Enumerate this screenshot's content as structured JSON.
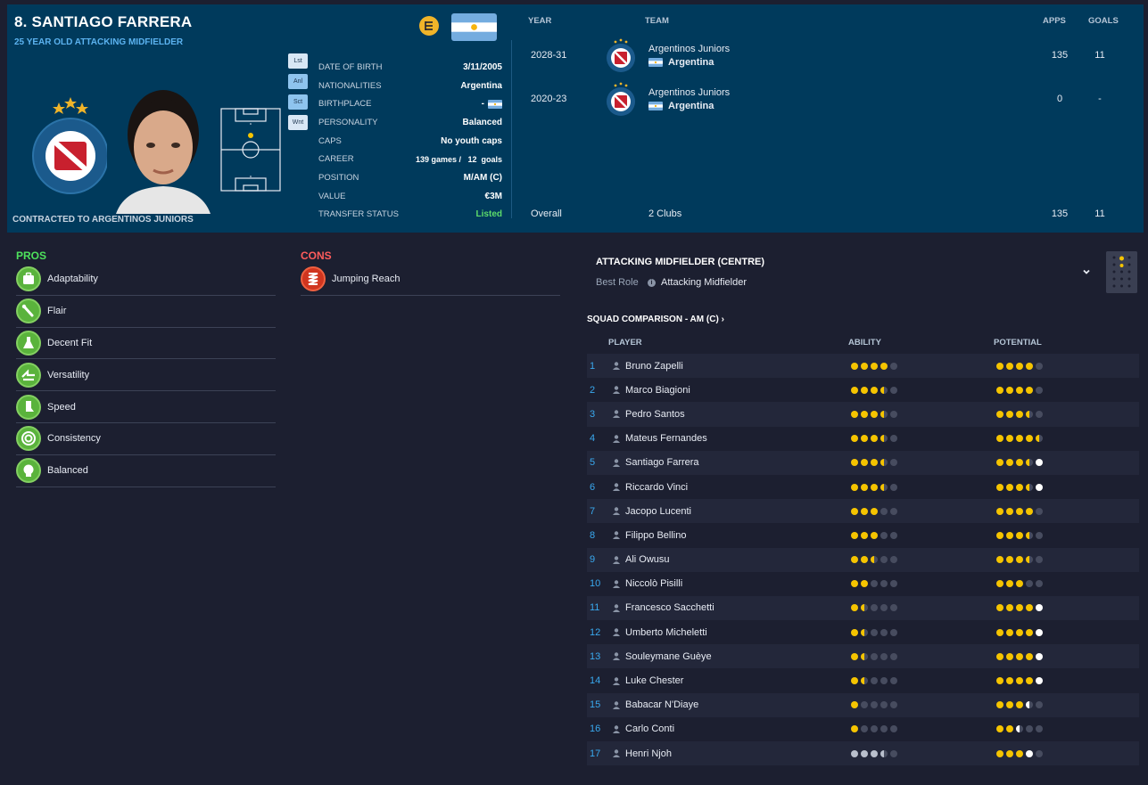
{
  "player": {
    "name": "8. SANTIAGO FARRERA",
    "subtitle": "25 YEAR OLD ATTACKING MIDFIELDER",
    "contract": "CONTRACTED TO ARGENTINOS JUNIORS"
  },
  "side_tabs": [
    "Lst",
    "Anl",
    "Sct",
    "Wnt"
  ],
  "info": {
    "rows": [
      {
        "label": "DATE OF BIRTH",
        "value": "3/11/2005"
      },
      {
        "label": "NATIONALITIES",
        "value": "Argentina"
      },
      {
        "label": "BIRTHPLACE",
        "value": "-"
      },
      {
        "label": "PERSONALITY",
        "value": "Balanced"
      },
      {
        "label": "CAPS",
        "value": "No youth caps"
      },
      {
        "label": "CAREER",
        "value": "139 games /   12  goals"
      },
      {
        "label": "POSITION",
        "value": "M/AM (C)"
      },
      {
        "label": "VALUE",
        "value": "€3M"
      },
      {
        "label": "TRANSFER STATUS",
        "value": "Listed"
      }
    ]
  },
  "history": {
    "headers": {
      "year": "YEAR",
      "team": "TEAM",
      "apps": "APPS",
      "goals": "GOALS"
    },
    "rows": [
      {
        "year": "2028-31",
        "club": "Argentinos Juniors",
        "nation": "Argentina",
        "apps": "135",
        "goals": "11"
      },
      {
        "year": "2020-23",
        "club": "Argentinos Juniors",
        "nation": "Argentina",
        "apps": "0",
        "goals": "-"
      }
    ],
    "total": {
      "label": "Overall",
      "clubs": "2 Clubs",
      "apps": "135",
      "goals": "11"
    }
  },
  "pros": {
    "title": "PROS",
    "items": [
      {
        "label": "Adaptability",
        "icon": "suitcase-icon"
      },
      {
        "label": "Flair",
        "icon": "paintbrush-icon"
      },
      {
        "label": "Decent Fit",
        "icon": "flask-icon"
      },
      {
        "label": "Versatility",
        "icon": "arrows-icon"
      },
      {
        "label": "Speed",
        "icon": "boot-icon"
      },
      {
        "label": "Consistency",
        "icon": "target-icon"
      },
      {
        "label": "Balanced",
        "icon": "head-icon"
      }
    ]
  },
  "cons": {
    "title": "CONS",
    "items": [
      {
        "label": "Jumping Reach",
        "icon": "spring-icon"
      }
    ]
  },
  "role": {
    "title": "ATTACKING MIDFIELDER (CENTRE)",
    "best_role_label": "Best Role",
    "best_role_value": "Attacking Midfielder"
  },
  "squad": {
    "title": "SQUAD COMPARISON - AM (C)",
    "headers": {
      "player": "PLAYER",
      "ability": "ABILITY",
      "potential": "POTENTIAL"
    },
    "rows": [
      {
        "num": "1",
        "name": "Bruno Zapelli",
        "ability": 4,
        "ability_color": "yellow",
        "potential": 4,
        "potential_white": 0
      },
      {
        "num": "2",
        "name": "Marco Biagioni",
        "ability": 3.5,
        "ability_color": "yellow",
        "potential": 4,
        "potential_white": 0
      },
      {
        "num": "3",
        "name": "Pedro Santos",
        "ability": 3.5,
        "ability_color": "yellow",
        "potential": 3.5,
        "potential_white": 0
      },
      {
        "num": "4",
        "name": "Mateus Fernandes",
        "ability": 3.5,
        "ability_color": "yellow",
        "potential": 4.5,
        "potential_white": 0
      },
      {
        "num": "5",
        "name": "Santiago Farrera",
        "ability": 3.5,
        "ability_color": "yellow",
        "potential": 3.5,
        "potential_white": 1
      },
      {
        "num": "6",
        "name": "Riccardo Vinci",
        "ability": 3.5,
        "ability_color": "yellow",
        "potential": 3.5,
        "potential_white": 1
      },
      {
        "num": "7",
        "name": "Jacopo Lucenti",
        "ability": 3,
        "ability_color": "yellow",
        "potential": 4,
        "potential_white": 0
      },
      {
        "num": "8",
        "name": "Filippo Bellino",
        "ability": 3,
        "ability_color": "yellow",
        "potential": 3.5,
        "potential_white": 0
      },
      {
        "num": "9",
        "name": "Ali Owusu",
        "ability": 2.5,
        "ability_color": "yellow",
        "potential": 3.5,
        "potential_white": 0
      },
      {
        "num": "10",
        "name": "Niccolò Pisilli",
        "ability": 2,
        "ability_color": "yellow",
        "potential": 3,
        "potential_white": 0
      },
      {
        "num": "11",
        "name": "Francesco Sacchetti",
        "ability": 1.5,
        "ability_color": "yellow",
        "potential": 4,
        "potential_white": 1
      },
      {
        "num": "12",
        "name": "Umberto Micheletti",
        "ability": 1.5,
        "ability_color": "yellow",
        "potential": 4,
        "potential_white": 1
      },
      {
        "num": "13",
        "name": "Souleymane Guèye",
        "ability": 1.5,
        "ability_color": "yellow",
        "potential": 4,
        "potential_white": 1
      },
      {
        "num": "14",
        "name": "Luke Chester",
        "ability": 1.5,
        "ability_color": "yellow",
        "potential": 4,
        "potential_white": 1
      },
      {
        "num": "15",
        "name": "Babacar N'Diaye",
        "ability": 1,
        "ability_color": "yellow",
        "potential": 3,
        "potential_white": 0.5
      },
      {
        "num": "16",
        "name": "Carlo Conti",
        "ability": 1,
        "ability_color": "yellow",
        "potential": 2,
        "potential_white": 0.5
      },
      {
        "num": "17",
        "name": "Henri Njoh",
        "ability": 3.5,
        "ability_color": "grey",
        "potential": 3,
        "potential_white": 1
      }
    ]
  },
  "colors": {
    "header_bg": "#003a5c",
    "page_bg": "#1c1f30",
    "accent_blue": "#39a9ef",
    "pros_green": "#4ee15c",
    "cons_red": "#ff5c5c",
    "star_yellow": "#f5c400"
  }
}
